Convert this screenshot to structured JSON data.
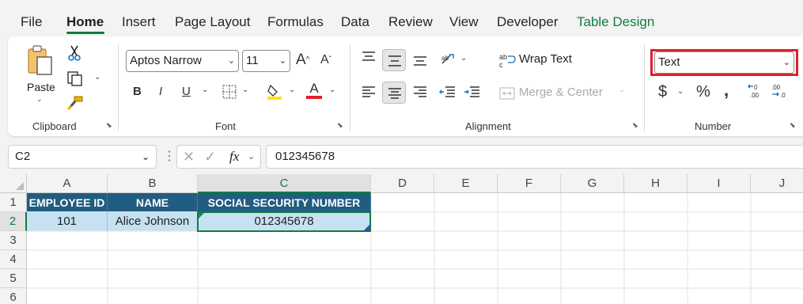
{
  "menu": {
    "items": [
      "File",
      "Home",
      "Insert",
      "Page Layout",
      "Formulas",
      "Data",
      "Review",
      "View",
      "Developer",
      "Table Design"
    ]
  },
  "ribbon": {
    "clipboard": {
      "paste_label": "Paste",
      "group_label": "Clipboard"
    },
    "font": {
      "font_name": "Aptos Narrow",
      "font_size": "11",
      "group_label": "Font"
    },
    "alignment": {
      "wrap_text": "Wrap Text",
      "merge_center": "Merge & Center",
      "group_label": "Alignment"
    },
    "number": {
      "format": "Text",
      "group_label": "Number",
      "highlight_color": "#e0202a"
    }
  },
  "formula_bar": {
    "name_box": "C2",
    "fx": "fx",
    "value": "012345678"
  },
  "grid": {
    "columns": [
      "A",
      "B",
      "C",
      "D",
      "E",
      "F",
      "G",
      "H",
      "I",
      "J"
    ],
    "rows": [
      "1",
      "2",
      "3",
      "4",
      "5",
      "6"
    ],
    "table": {
      "headers": [
        "EMPLOYEE ID",
        "NAME",
        "SOCIAL SECURITY NUMBER"
      ],
      "row": [
        "101",
        "Alice Johnson",
        "012345678"
      ],
      "header_color": "#215c81",
      "band_color": "#c5e1f2"
    }
  }
}
